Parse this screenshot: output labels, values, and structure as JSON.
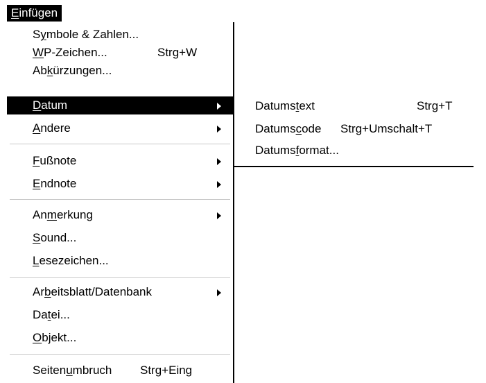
{
  "menu_bar": {
    "title_underline": "E",
    "title_rest": "infügen"
  },
  "menu": {
    "items": [
      {
        "pre": "S",
        "u": "y",
        "post": "mbole & Zahlen...",
        "shortcut": ""
      },
      {
        "pre": "",
        "u": "W",
        "post": "P-Zeichen...",
        "shortcut": "Strg+W"
      },
      {
        "pre": "Ab",
        "u": "k",
        "post": "ürzungen...",
        "shortcut": ""
      },
      {
        "pre": "",
        "u": "D",
        "post": "atum",
        "shortcut": "",
        "submenu": true,
        "selected": true
      },
      {
        "pre": "",
        "u": "A",
        "post": "ndere",
        "shortcut": "",
        "submenu": true
      },
      {
        "pre": "",
        "u": "F",
        "post": "ußnote",
        "shortcut": "",
        "submenu": true
      },
      {
        "pre": "",
        "u": "E",
        "post": "ndnote",
        "shortcut": "",
        "submenu": true
      },
      {
        "pre": "An",
        "u": "m",
        "post": "erkung",
        "shortcut": "",
        "submenu": true
      },
      {
        "pre": "",
        "u": "S",
        "post": "ound...",
        "shortcut": ""
      },
      {
        "pre": "",
        "u": "L",
        "post": "esezeichen...",
        "shortcut": ""
      },
      {
        "pre": "Ar",
        "u": "b",
        "post": "eitsblatt/Datenbank",
        "shortcut": "",
        "submenu": true
      },
      {
        "pre": "Da",
        "u": "t",
        "post": "ei...",
        "shortcut": ""
      },
      {
        "pre": "",
        "u": "O",
        "post": "bjekt...",
        "shortcut": ""
      },
      {
        "pre": "Seiten",
        "u": "u",
        "post": "mbruch",
        "shortcut": "Strg+Eing"
      }
    ]
  },
  "submenu": {
    "items": [
      {
        "pre": "Datums",
        "u": "t",
        "post": "ext",
        "shortcut": "Strg+T"
      },
      {
        "pre": "Datums",
        "u": "c",
        "post": "ode",
        "shortcut": "Strg+Umschalt+T"
      },
      {
        "pre": "Datums",
        "u": "f",
        "post": "ormat...",
        "shortcut": ""
      }
    ]
  },
  "colors": {
    "highlight_bg": "#000000",
    "highlight_fg": "#ffffff",
    "separator": "#c8c8c8"
  }
}
